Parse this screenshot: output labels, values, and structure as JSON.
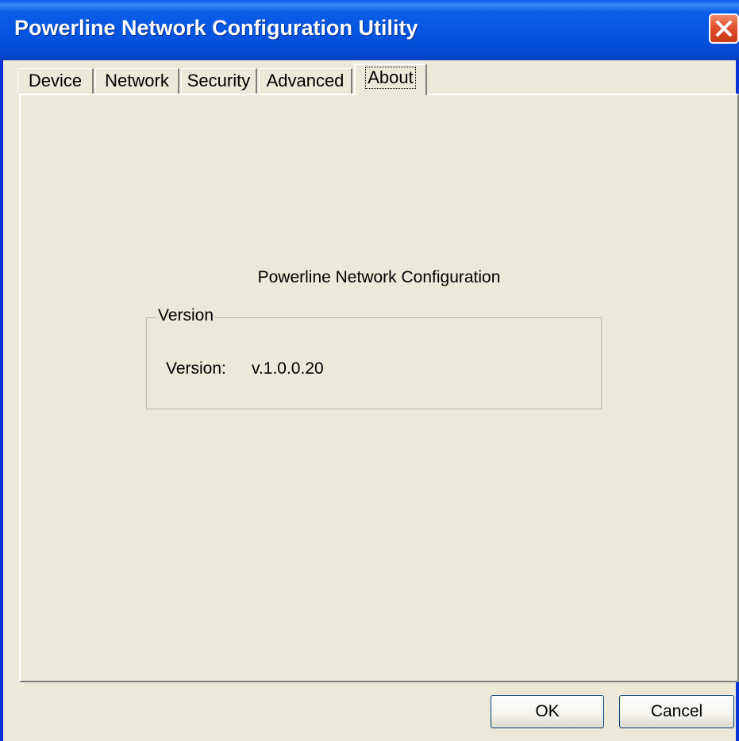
{
  "window": {
    "title": "Powerline Network Configuration Utility"
  },
  "tabs": [
    {
      "label": "Device",
      "active": false
    },
    {
      "label": "Network",
      "active": false
    },
    {
      "label": "Security",
      "active": false
    },
    {
      "label": "Advanced",
      "active": false
    },
    {
      "label": "About",
      "active": true
    }
  ],
  "about": {
    "product_name": "Powerline Network Configuration",
    "group_title": "Version",
    "version_label": "Version:",
    "version_value": "v.1.0.0.20"
  },
  "buttons": {
    "ok_label": "OK",
    "cancel_label": "Cancel"
  },
  "colors": {
    "titlebar": "#0554e0",
    "close_button": "#e0502a",
    "dialog_background": "#ece9d8"
  },
  "icons": {
    "close": "close-icon"
  }
}
